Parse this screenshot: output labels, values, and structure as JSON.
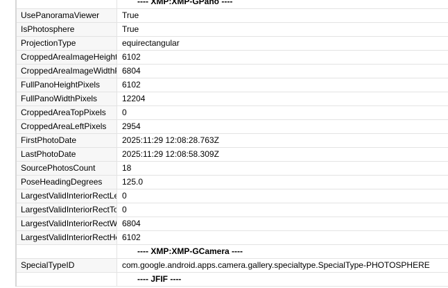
{
  "sections": {
    "gpano_header": "---- XMP:XMP-GPano ----",
    "gcamera_header": "---- XMP:XMP-GCamera ----",
    "jfif_header": "---- JFIF ----"
  },
  "gpano_rows": [
    {
      "name": "UsePanoramaViewer",
      "value": "True"
    },
    {
      "name": "IsPhotosphere",
      "value": "True"
    },
    {
      "name": "ProjectionType",
      "value": "equirectangular"
    },
    {
      "name": "CroppedAreaImageHeight",
      "value": "6102"
    },
    {
      "name": "CroppedAreaImageWidthP",
      "value": "6804"
    },
    {
      "name": "FullPanoHeightPixels",
      "value": "6102"
    },
    {
      "name": "FullPanoWidthPixels",
      "value": "12204"
    },
    {
      "name": "CroppedAreaTopPixels",
      "value": "0"
    },
    {
      "name": "CroppedAreaLeftPixels",
      "value": "2954"
    },
    {
      "name": "FirstPhotoDate",
      "value": "2025:11:29 12:08:28.763Z"
    },
    {
      "name": "LastPhotoDate",
      "value": "2025:11:29 12:08:58.309Z"
    },
    {
      "name": "SourcePhotosCount",
      "value": "18"
    },
    {
      "name": "PoseHeadingDegrees",
      "value": "125.0"
    },
    {
      "name": "LargestValidInteriorRectLef",
      "value": "0"
    },
    {
      "name": "LargestValidInteriorRectTo",
      "value": "0"
    },
    {
      "name": "LargestValidInteriorRectWi",
      "value": "6804"
    },
    {
      "name": "LargestValidInteriorRectHe",
      "value": "6102"
    }
  ],
  "gcamera_rows": [
    {
      "name": "SpecialTypeID",
      "value": "com.google.android.apps.camera.gallery.specialtype.SpecialType-PHOTOSPHERE"
    }
  ]
}
